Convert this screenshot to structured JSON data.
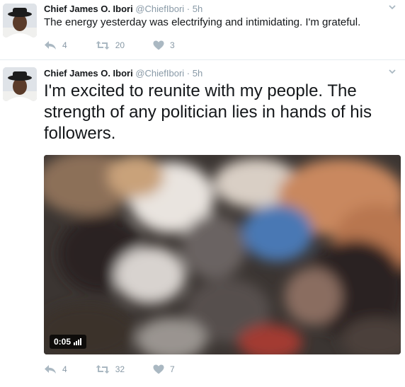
{
  "tweets": [
    {
      "author_name": "Chief James O. Ibori",
      "handle": "@ChiefIbori",
      "separator": "·",
      "time": "5h",
      "text": "The energy yesterday was electrifying and intimidating. I'm grateful.",
      "reply_count": "4",
      "retweet_count": "20",
      "like_count": "3"
    },
    {
      "author_name": "Chief James O. Ibori",
      "handle": "@ChiefIbori",
      "separator": "·",
      "time": "5h",
      "text": "I'm excited to reunite with my people. The strength of any politician lies in hands of his followers.",
      "video_duration": "0:05",
      "reply_count": "4",
      "retweet_count": "32",
      "like_count": "7"
    }
  ],
  "icons": {
    "reply": "reply-icon",
    "retweet": "retweet-icon",
    "like": "heart-icon",
    "menu": "chevron-down-icon",
    "volume": "volume-bars-icon"
  },
  "colors": {
    "action_icon": "#aab8c2",
    "meta_text": "#8899a6",
    "divider": "#e6ecf0"
  }
}
